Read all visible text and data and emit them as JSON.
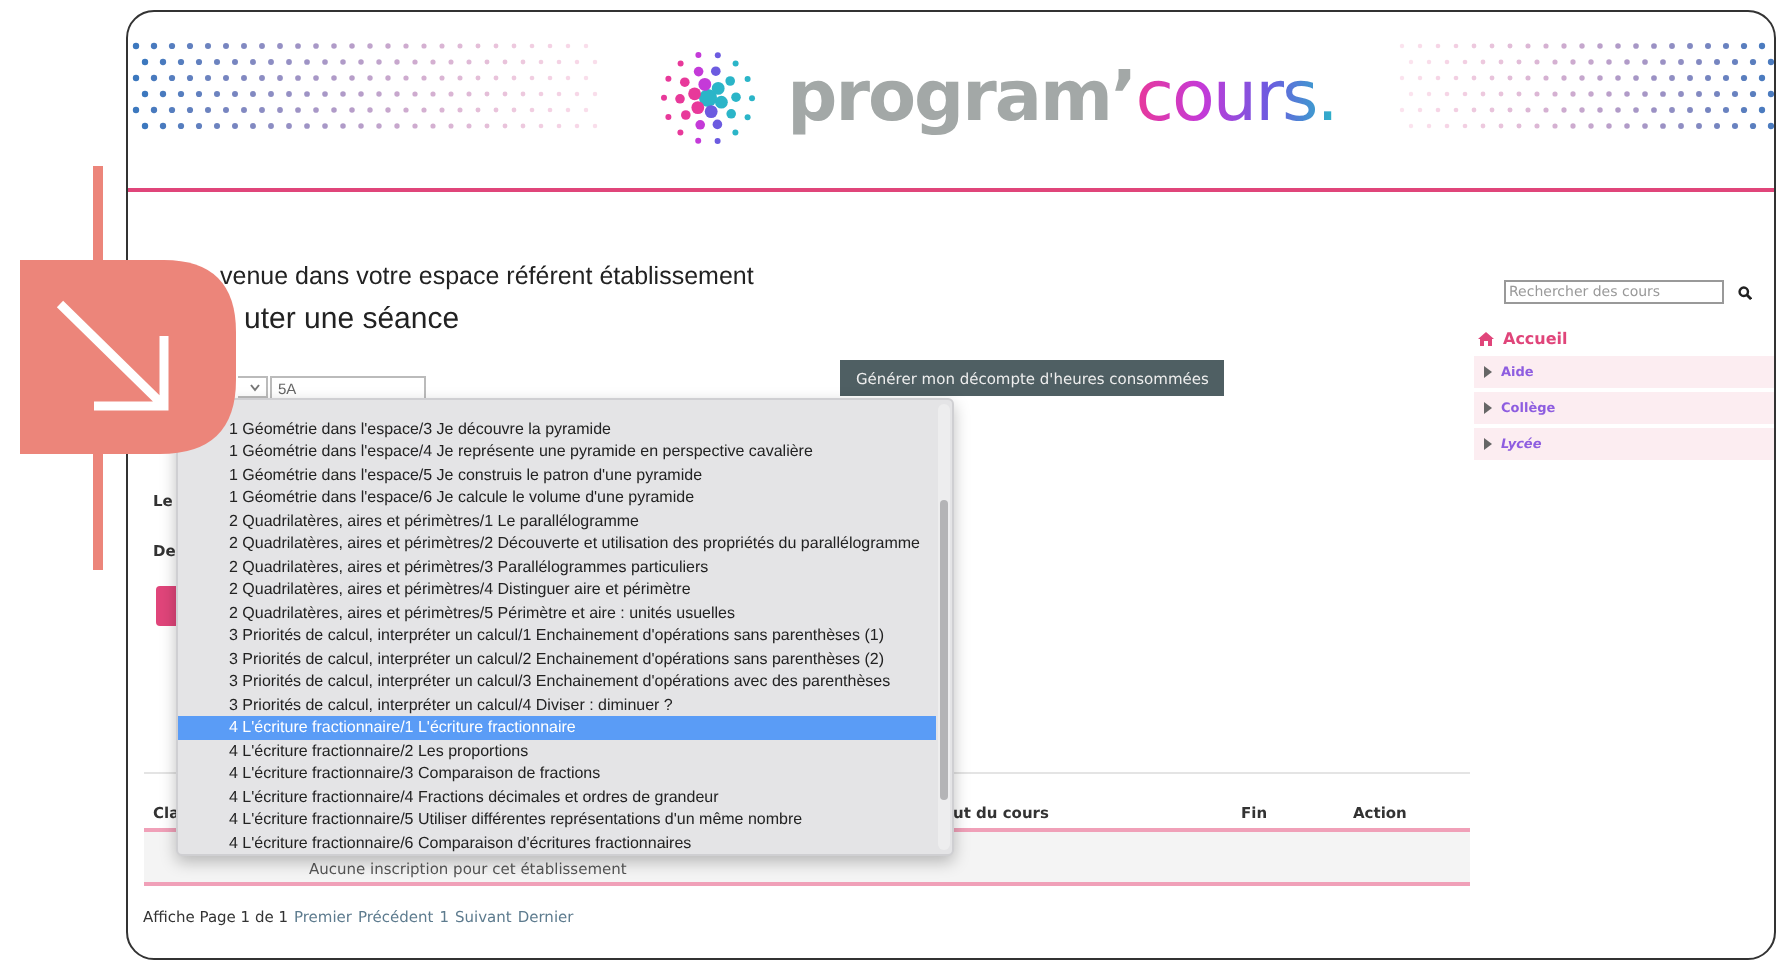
{
  "logo": {
    "wordmark": "program’",
    "accent": "cours."
  },
  "page": {
    "welcome": "venue dans votre espace référent établissement",
    "heading": "uter une séance"
  },
  "form": {
    "select_value": "5A",
    "labels": [
      "Le",
      "De"
    ],
    "generate_button": "Générer mon décompte d'heures consommées"
  },
  "dropdown": {
    "items": [
      {
        "label": "1 Géométrie dans l'espace/3 Je découvre la pyramide",
        "selected": false
      },
      {
        "label": "1 Géométrie dans l'espace/4 Je représente une pyramide en perspective cavalière",
        "selected": false
      },
      {
        "label": "1 Géométrie dans l'espace/5 Je construis le patron d'une pyramide",
        "selected": false
      },
      {
        "label": "1 Géométrie dans l'espace/6 Je calcule le volume d'une pyramide",
        "selected": false
      },
      {
        "label": "2 Quadrilatères, aires et périmètres/1 Le parallélogramme",
        "selected": false
      },
      {
        "label": "2 Quadrilatères, aires et périmètres/2 Découverte et utilisation des propriétés du parallélogramme",
        "selected": false
      },
      {
        "label": "2 Quadrilatères, aires et périmètres/3 Parallélogrammes particuliers",
        "selected": false
      },
      {
        "label": "2 Quadrilatères, aires et périmètres/4 Distinguer aire et périmètre",
        "selected": false
      },
      {
        "label": "2 Quadrilatères, aires et périmètres/5 Périmètre et aire : unités usuelles",
        "selected": false
      },
      {
        "label": "3 Priorités de calcul, interpréter un calcul/1 Enchainement d'opérations sans parenthèses (1)",
        "selected": false
      },
      {
        "label": "3 Priorités de calcul, interpréter un calcul/2 Enchainement d'opérations sans parenthèses (2)",
        "selected": false
      },
      {
        "label": "3 Priorités de calcul, interpréter un calcul/3 Enchainement d'opérations avec des parenthèses",
        "selected": false
      },
      {
        "label": "3 Priorités de calcul, interpréter un calcul/4 Diviser : diminuer ?",
        "selected": false
      },
      {
        "label": "4 L'écriture fractionnaire/1 L'écriture fractionnaire",
        "selected": true
      },
      {
        "label": "4 L'écriture fractionnaire/2 Les proportions",
        "selected": false
      },
      {
        "label": "4 L'écriture fractionnaire/3 Comparaison de fractions",
        "selected": false
      },
      {
        "label": "4 L'écriture fractionnaire/4 Fractions décimales et ordres de grandeur",
        "selected": false
      },
      {
        "label": "4 L'écriture fractionnaire/5 Utiliser différentes représentations d'un même nombre",
        "selected": false
      },
      {
        "label": "4 L'écriture fractionnaire/6 Comparaison d'écritures fractionnaires",
        "selected": false
      }
    ]
  },
  "search": {
    "placeholder": "Rechercher des cours"
  },
  "nav": [
    {
      "label": "Accueil",
      "kind": "home",
      "selected": true,
      "italic": false
    },
    {
      "label": "Aide",
      "kind": "branch",
      "selected": false,
      "italic": false
    },
    {
      "label": "Collège",
      "kind": "branch",
      "selected": false,
      "italic": false
    },
    {
      "label": "Lycée",
      "kind": "branch",
      "selected": false,
      "italic": true
    }
  ],
  "table": {
    "columns": [
      "Cla",
      "ut du cours",
      "Fin",
      "Action"
    ],
    "empty_message": "Aucune inscription pour cet établissement"
  },
  "pagination": {
    "summary": "Affiche Page 1 de 1",
    "links": [
      "Premier",
      "Précédent",
      "1",
      "Suivant",
      "Dernier"
    ]
  }
}
